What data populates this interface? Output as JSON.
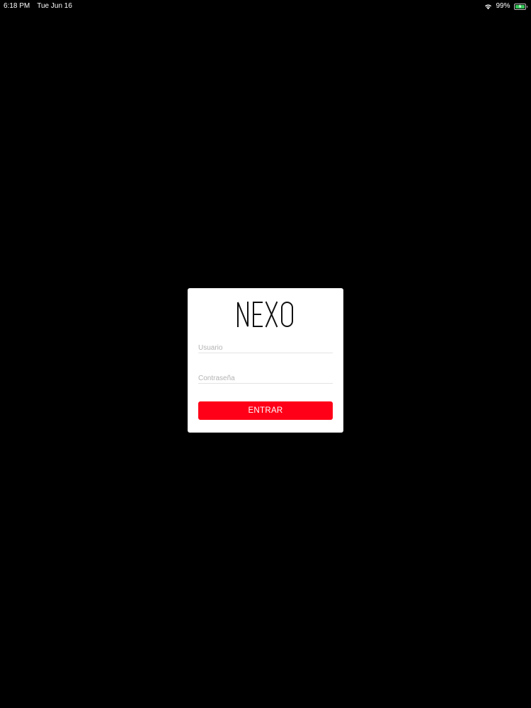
{
  "status_bar": {
    "time": "6:18 PM",
    "date": "Tue Jun 16",
    "battery": "99%",
    "wifi_icon": "wifi-icon",
    "battery_icon": "battery-charging-icon"
  },
  "login": {
    "logo_text": "NEXO",
    "username": {
      "placeholder": "Usuario",
      "value": ""
    },
    "password": {
      "placeholder": "Contraseña",
      "value": ""
    },
    "submit_label": "ENTRAR"
  },
  "colors": {
    "background": "#000000",
    "card": "#ffffff",
    "accent": "#ff0018",
    "battery": "#35c759"
  }
}
